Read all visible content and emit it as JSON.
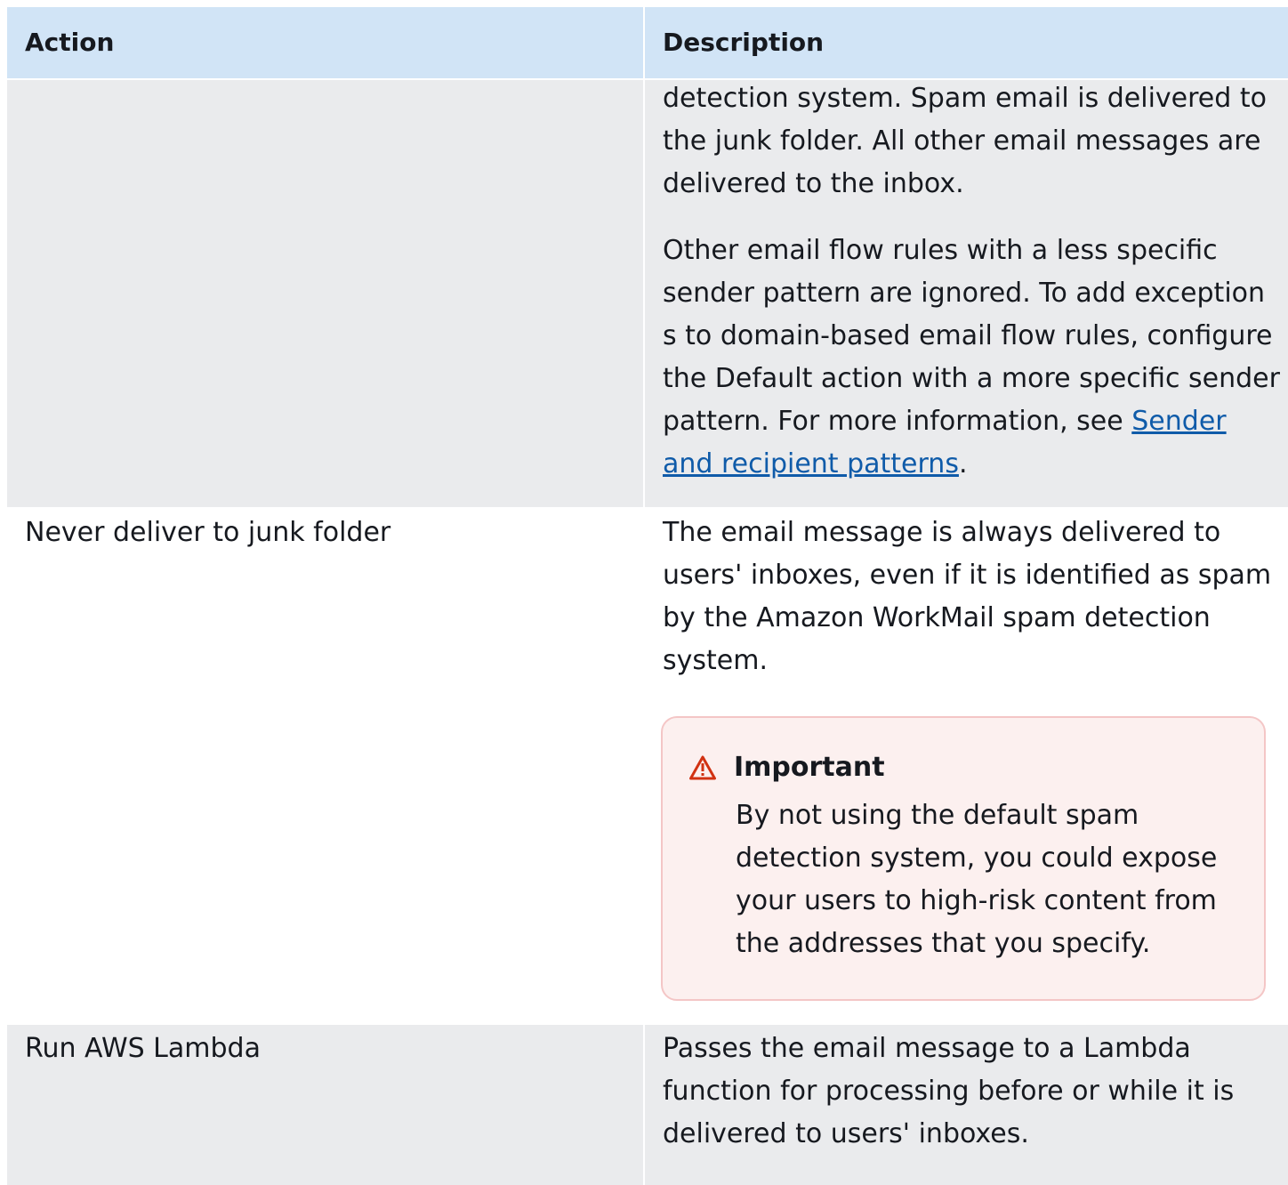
{
  "table": {
    "headers": {
      "action": "Action",
      "description": "Description"
    },
    "rows": [
      {
        "action": "",
        "description_paragraphs": [
          "detection system. Spam email is delivered to the junk folder. All other email messages are delivered to the inbox.",
          "Other email flow rules with a less specific sender pattern are ignored. To add exception s to domain-based email flow rules, configure the Default action with a more specific sender pattern. For more information, see "
        ],
        "link_text": "Sender and recipient patterns",
        "trailing": "."
      },
      {
        "action": "Never deliver to junk folder",
        "description": "The email message is always delivered to users' inboxes, even if it is identified as spam by the Amazon WorkMail spam detection  system.",
        "callout": {
          "title": "Important",
          "body": "By not using the default spam detection system, you could expose your users to high-risk content from the addresses that you specify.",
          "icon": "warning-triangle-icon",
          "color": "#d13212"
        }
      },
      {
        "action": "Run AWS Lambda",
        "description": "Passes the email message to a Lambda function for processing before or while it is delivered to users' inboxes."
      }
    ]
  },
  "colors": {
    "header_bg": "#d1e4f6",
    "stripe_bg": "#eaebed",
    "link": "#0f5ba9",
    "callout_bg": "#fcf0ef",
    "callout_border": "#f4c6c6"
  }
}
